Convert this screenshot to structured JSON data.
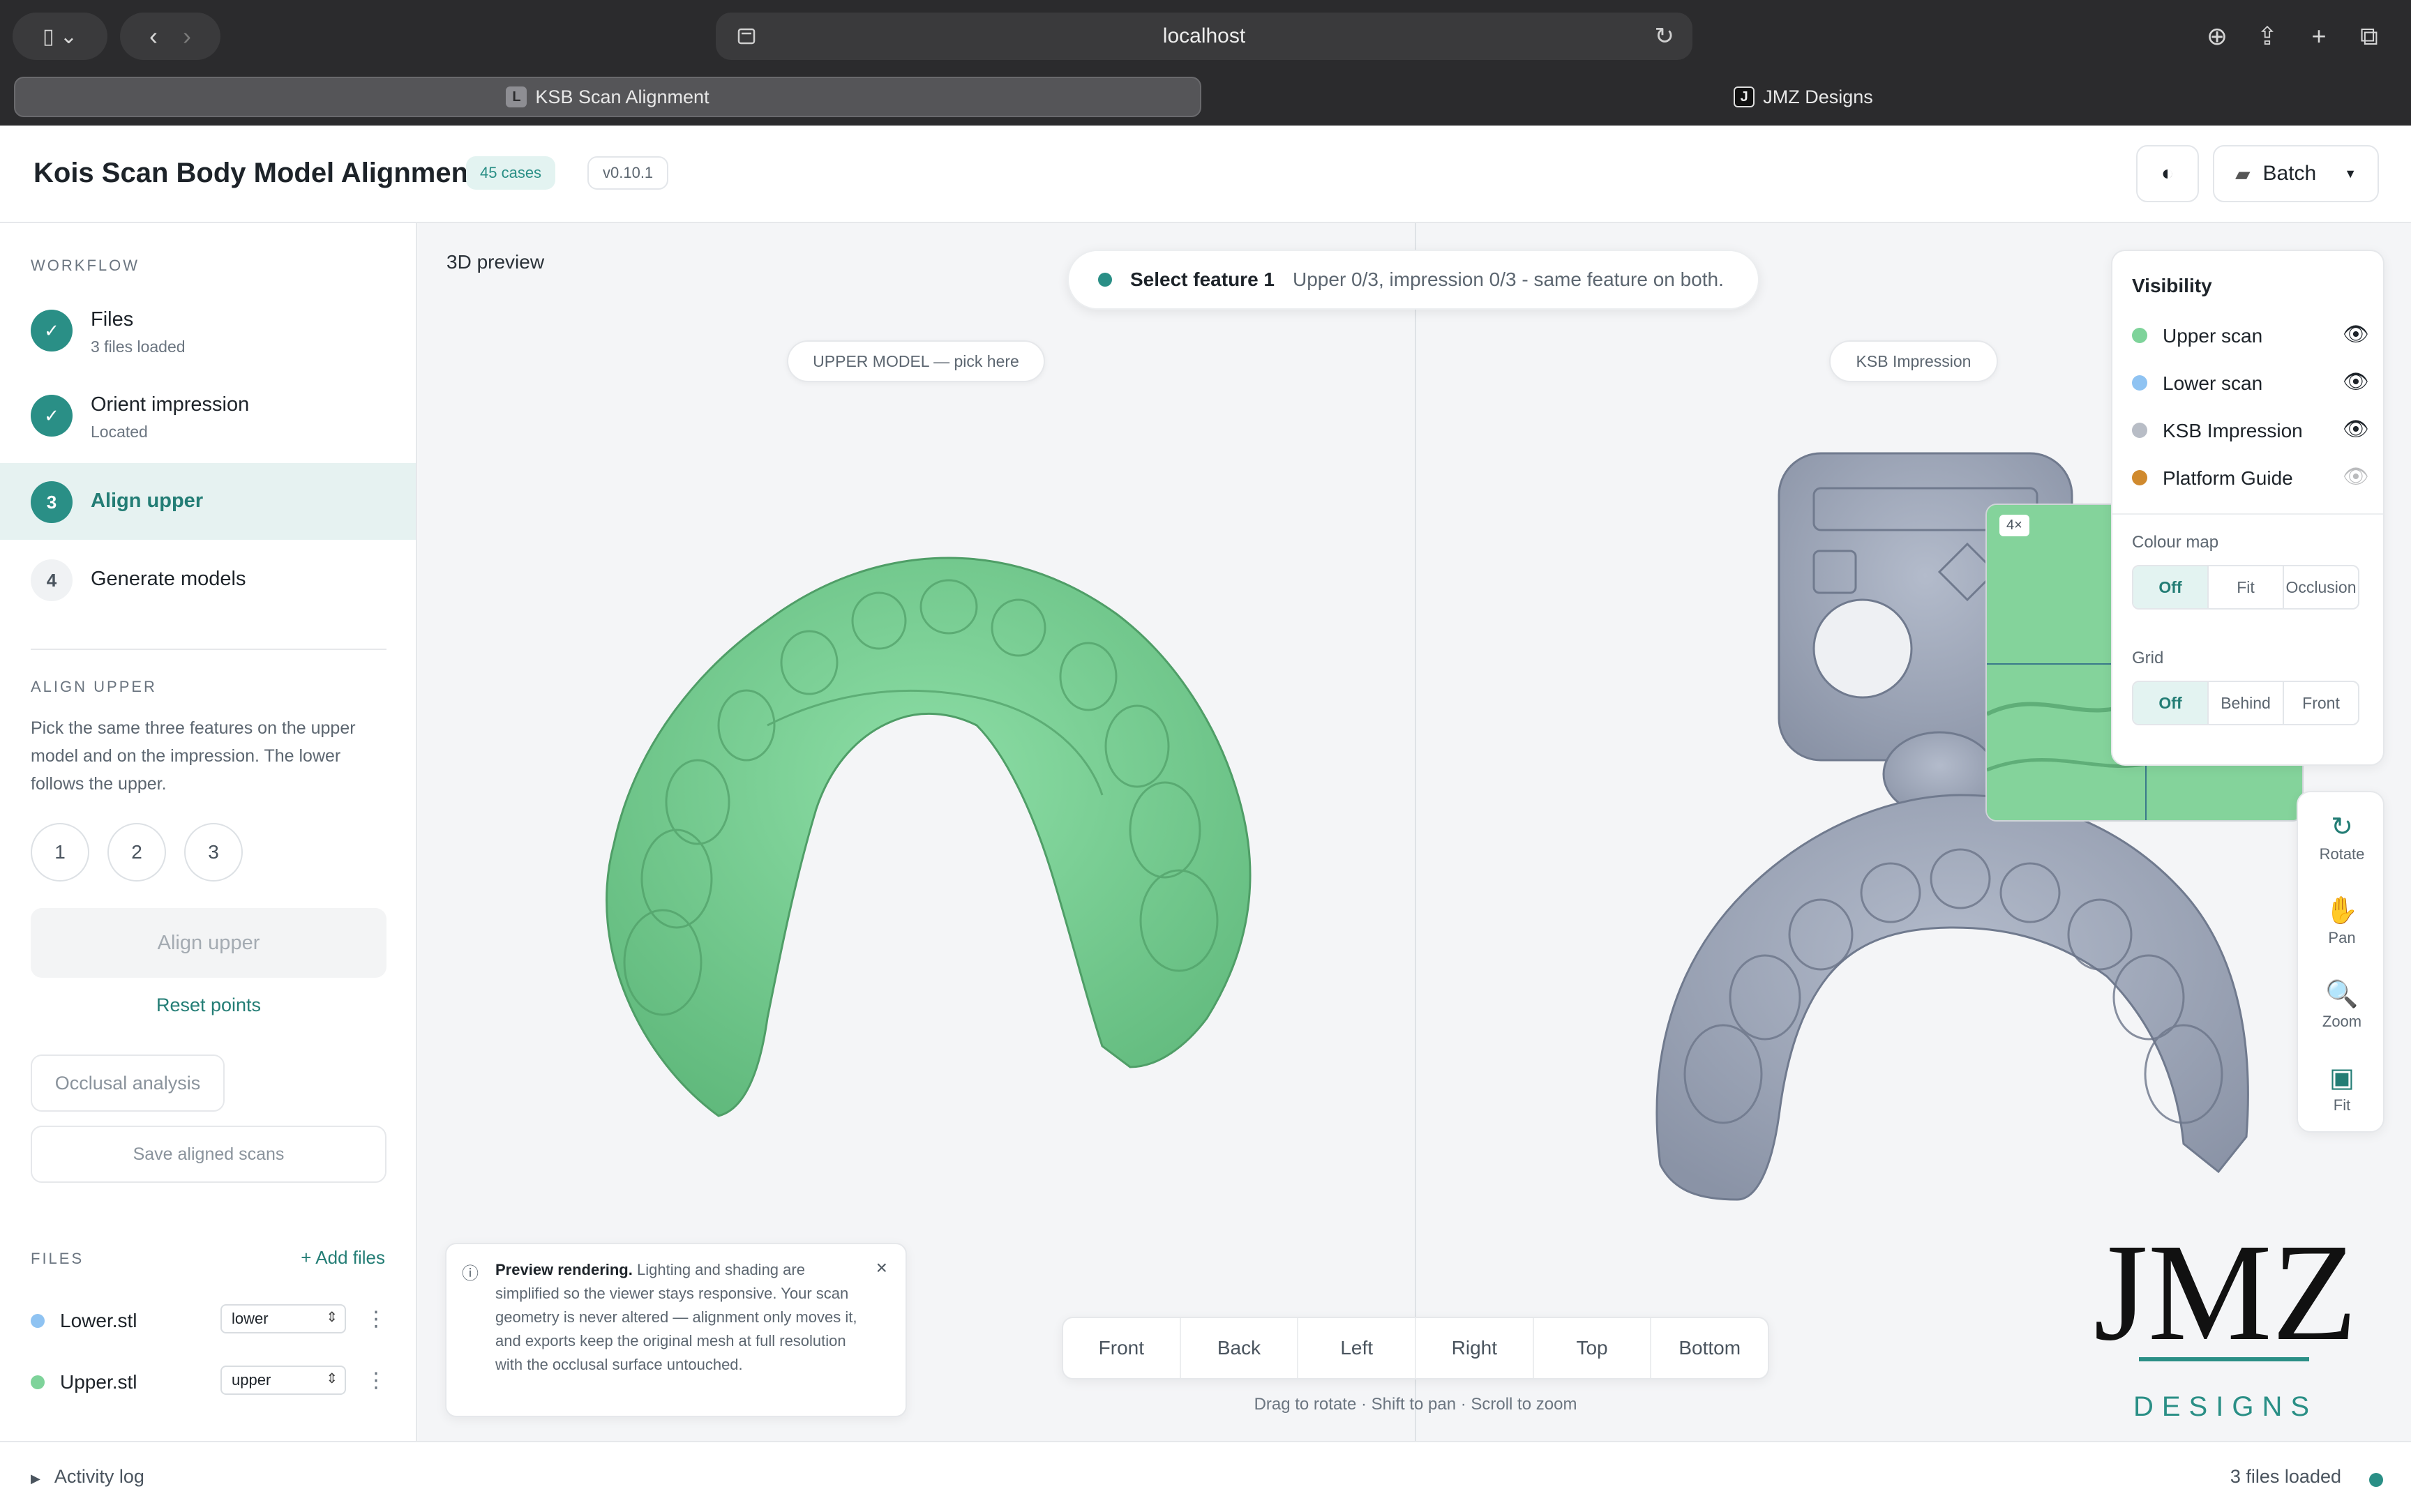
{
  "browser": {
    "url": "localhost",
    "tabs": [
      {
        "label": "KSB Scan Alignment",
        "favicon": "L",
        "active": true
      },
      {
        "label": "JMZ Designs",
        "favicon": "J",
        "active": false
      }
    ]
  },
  "header": {
    "title": "Kois Scan Body Model Alignment",
    "cases_badge": "45 cases",
    "version_badge": "v0.10.1",
    "theme_icon": "contrast-icon",
    "batch_label": "Batch"
  },
  "sidebar": {
    "workflow_label": "WORKFLOW",
    "steps": [
      {
        "badge": "✓",
        "title": "Files",
        "subtitle": "3 files loaded",
        "state": "done"
      },
      {
        "badge": "✓",
        "title": "Orient impression",
        "subtitle": "Located",
        "state": "done"
      },
      {
        "badge": "3",
        "title": "Align upper",
        "subtitle": "",
        "state": "current"
      },
      {
        "badge": "4",
        "title": "Generate models",
        "subtitle": "",
        "state": "todo"
      }
    ],
    "align_section_label": "ALIGN UPPER",
    "align_description": "Pick the same three features on the upper model and on the impression. The lower follows the upper.",
    "points": [
      "1",
      "2",
      "3"
    ],
    "align_button": "Align upper",
    "reset_link": "Reset points",
    "occlusal_button": "Occlusal analysis",
    "save_button": "Save aligned scans",
    "files_label": "FILES",
    "add_files_link": "+ Add files",
    "files": [
      {
        "name": "Lower.stl",
        "role": "lower",
        "color": "#8fc3f2"
      },
      {
        "name": "Upper.stl",
        "role": "upper",
        "color": "#7ed39a"
      }
    ]
  },
  "viewport": {
    "label": "3D preview",
    "status": {
      "title": "Select feature 1",
      "detail": "Upper 0/3, impression 0/3 - same feature on both."
    },
    "upper_tag": "UPPER MODEL — pick here",
    "impression_tag": "KSB Impression",
    "zoom_label": "4×",
    "visibility": {
      "title": "Visibility",
      "layers": [
        {
          "name": "Upper scan",
          "color": "#7ed39a",
          "visible": true
        },
        {
          "name": "Lower scan",
          "color": "#8fc3f2",
          "visible": true
        },
        {
          "name": "KSB Impression",
          "color": "#b8bdc6",
          "visible": true
        },
        {
          "name": "Platform Guide",
          "color": "#d08a2e",
          "visible": false
        }
      ],
      "colour_map_label": "Colour map",
      "colour_map_options": [
        "Off",
        "Fit",
        "Occlusion"
      ],
      "grid_label": "Grid",
      "grid_options": [
        "Off",
        "Behind",
        "Front"
      ]
    },
    "tools": [
      {
        "label": "Rotate",
        "icon": "↻"
      },
      {
        "label": "Pan",
        "icon": "✋"
      },
      {
        "label": "Zoom",
        "icon": "🔍"
      },
      {
        "label": "Fit",
        "icon": "▣"
      }
    ],
    "views": [
      "Front",
      "Back",
      "Left",
      "Right",
      "Top",
      "Bottom"
    ],
    "hint": "Drag to rotate · Shift to pan · Scroll to zoom",
    "toast": {
      "title": "Preview rendering.",
      "body": "Lighting and shading are simplified so the viewer stays responsive. Your scan geometry is never altered — alignment only moves it, and exports keep the original mesh at full resolution with the occlusal surface untouched."
    },
    "logo": {
      "main": "JMZ",
      "sub": "DESIGNS",
      "accent": "#2a8f86"
    }
  },
  "footer": {
    "activity_log": "Activity log",
    "status": "3 files loaded"
  },
  "colors": {
    "accent": "#2a8f86",
    "upper_model": "#7ed39a",
    "impression": "#9aa3b4"
  }
}
